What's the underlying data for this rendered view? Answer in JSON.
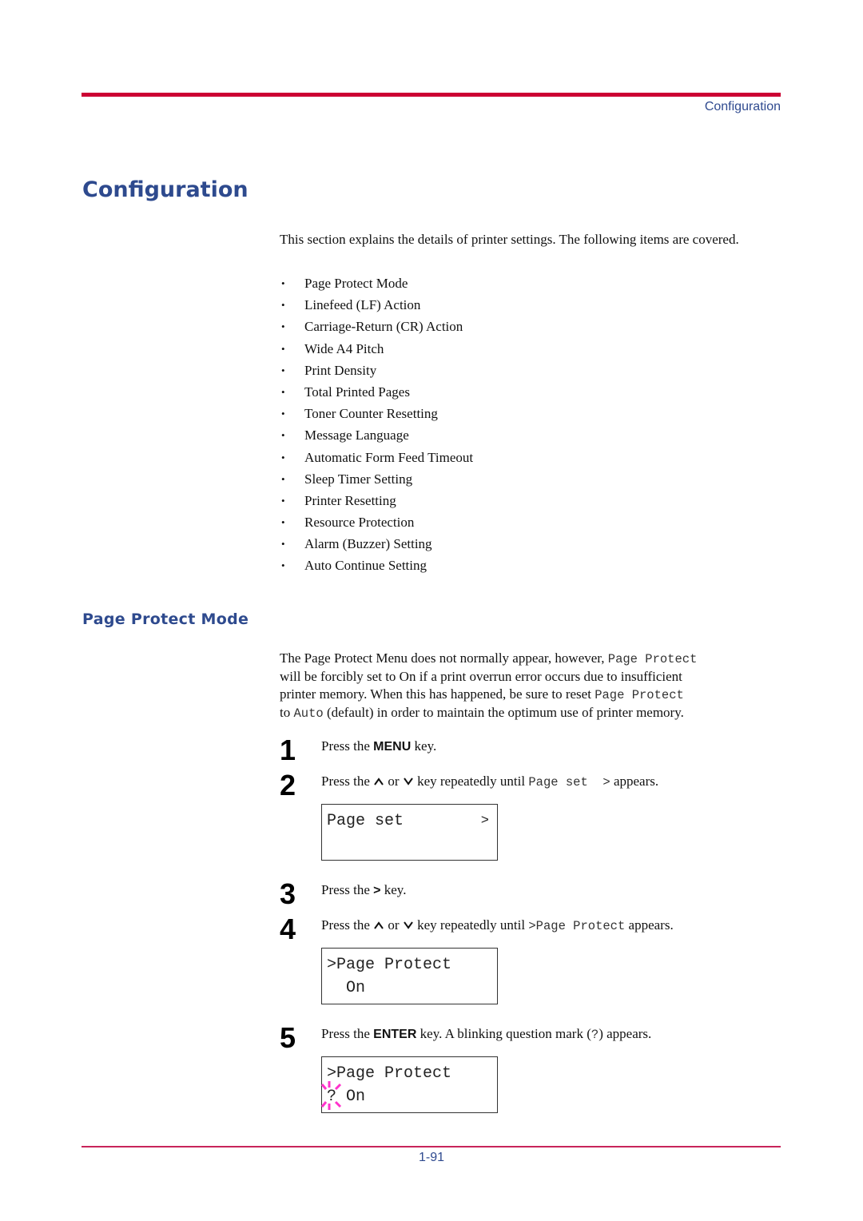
{
  "header": {
    "running_head": "Configuration"
  },
  "page_title": "Configuration",
  "intro": "This section explains the details of printer settings. The following items are covered.",
  "topics": [
    "Page Protect Mode",
    "Linefeed (LF) Action",
    "Carriage-Return (CR) Action",
    "Wide A4 Pitch",
    "Print Density",
    "Total Printed Pages",
    "Toner Counter Resetting",
    "Message Language",
    "Automatic Form Feed Timeout",
    "Sleep Timer Setting",
    "Printer Resetting",
    "Resource Protection",
    "Alarm (Buzzer) Setting",
    "Auto Continue Setting"
  ],
  "bullet_glyph": "•",
  "section": {
    "title": "Page Protect Mode",
    "para": {
      "l1_a": "The Page Protect Menu does not normally appear, however, ",
      "l1_mono": "Page Protect",
      "l2": "will be forcibly set to On if a print overrun error occurs due to insufficient",
      "l3_a": "printer memory. When this has happened, be sure to reset ",
      "l3_mono": "Page Protect",
      "l4_a": "to ",
      "l4_mono": "Auto",
      "l4_b": " (default) in order to maintain the optimum use of printer memory."
    }
  },
  "steps": [
    {
      "num": "1",
      "pre": "Press the ",
      "key": "MENU",
      "post": " key."
    },
    {
      "num": "2",
      "pre": "Press the ",
      "mid1": " or ",
      "mid2": " key repeatedly until ",
      "mono": "Page set  >",
      "post": " appears.",
      "icons": [
        "up-arrow-icon",
        "down-arrow-icon"
      ]
    },
    {
      "num": "3",
      "pre": "Press the ",
      "key": ">",
      "post": " key."
    },
    {
      "num": "4",
      "pre": "Press the ",
      "mid1": " or ",
      "mid2": " key repeatedly until ",
      "mono": ">Page Protect",
      "post": " appears.",
      "icons": [
        "up-arrow-icon",
        "down-arrow-icon"
      ]
    },
    {
      "num": "5",
      "pre": "Press the ",
      "key": "ENTER",
      "mid": " key. A blinking question mark (",
      "mono": "?",
      "post": ") appears."
    }
  ],
  "lcd_screens": [
    {
      "line1": "Page set",
      "line2": "",
      "arrow": ">"
    },
    {
      "line1": ">Page Protect",
      "line2": "  On"
    },
    {
      "line1": ">Page Protect",
      "line2": "? On",
      "blink_color": "#ff33cc"
    }
  ],
  "footer": {
    "page_number": "1-91"
  },
  "colors": {
    "rule_top": "#cc0033",
    "rule_bottom": "#c8245a",
    "heading_blue": "#2e4a8e",
    "blink_magenta": "#ff33cc"
  }
}
